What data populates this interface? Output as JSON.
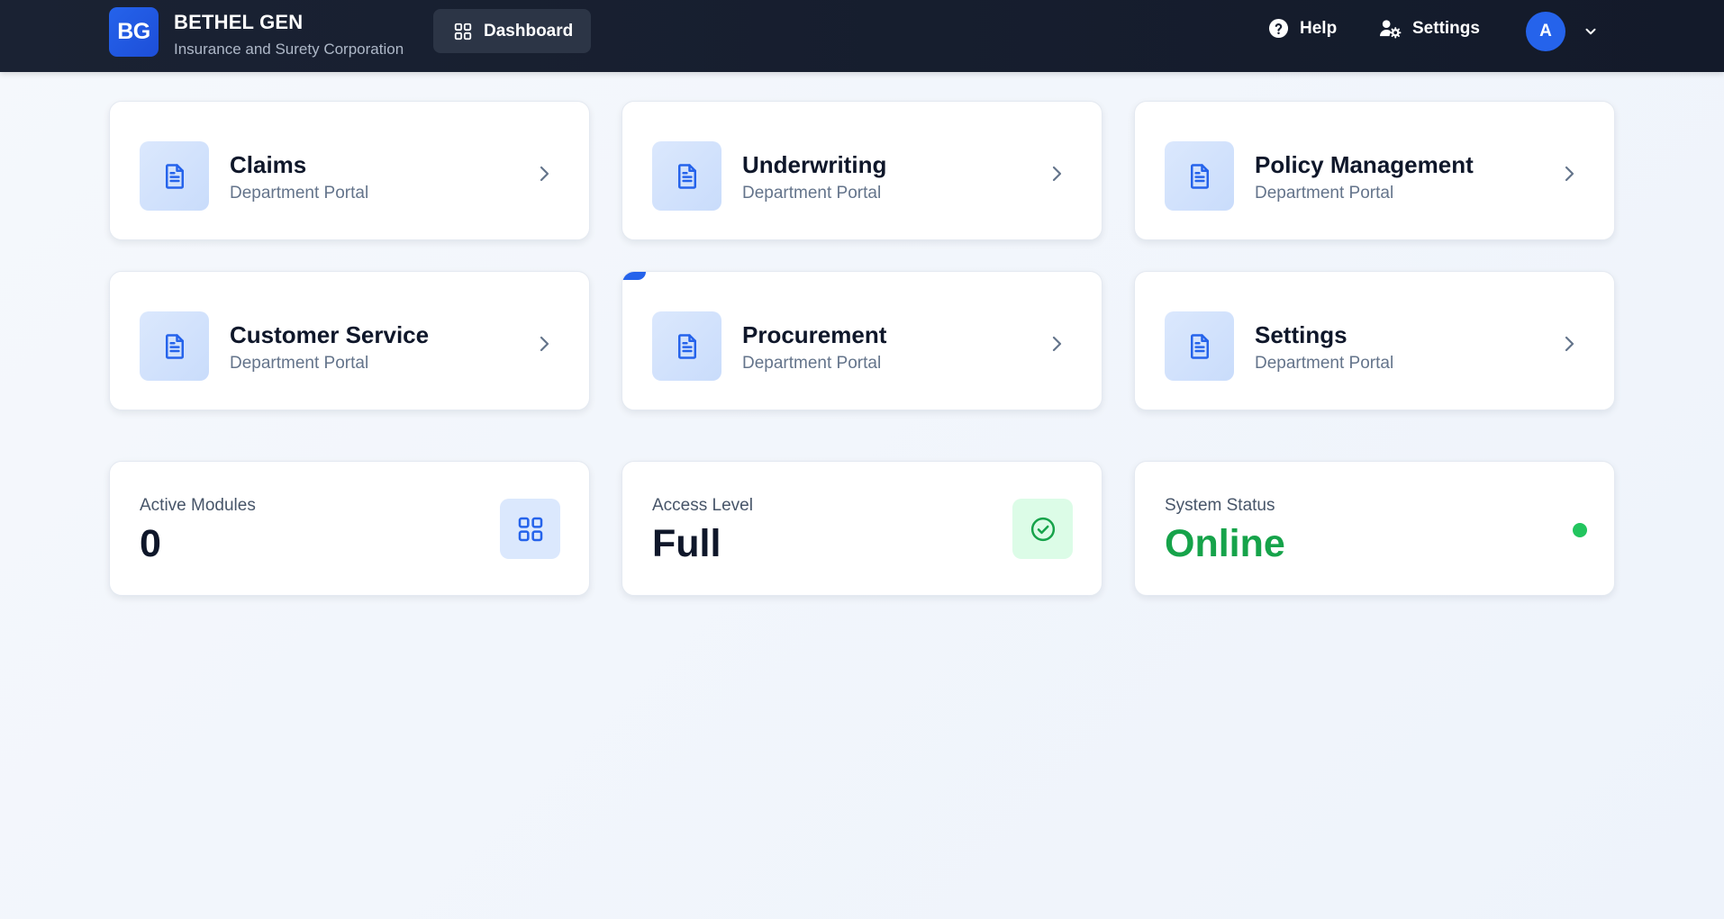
{
  "header": {
    "logo_text": "BG",
    "brand_name": "BETHEL GEN",
    "brand_subtitle": "Insurance and Surety Corporation",
    "nav_dashboard": "Dashboard",
    "help": "Help",
    "settings": "Settings",
    "avatar_initial": "A"
  },
  "modules": [
    {
      "title": "Claims",
      "subtitle": "Department Portal"
    },
    {
      "title": "Underwriting",
      "subtitle": "Department Portal"
    },
    {
      "title": "Policy Management",
      "subtitle": "Department Portal"
    },
    {
      "title": "Customer Service",
      "subtitle": "Department Portal"
    },
    {
      "title": "Procurement",
      "subtitle": "Department Portal"
    },
    {
      "title": "Settings",
      "subtitle": "Department Portal"
    }
  ],
  "stats": {
    "active_modules": {
      "label": "Active Modules",
      "value": "0"
    },
    "access_level": {
      "label": "Access Level",
      "value": "Full"
    },
    "system_status": {
      "label": "System Status",
      "value": "Online"
    }
  },
  "colors": {
    "accent": "#2563eb",
    "header_bg": "#1a2233",
    "status_green": "#16a34a",
    "status_dot": "#22c55e"
  },
  "icons": {
    "module_icon": "document-icon",
    "chevron": "chevron-right-icon",
    "active_modules_badge": "grid-icon",
    "access_level_badge": "check-circle-icon"
  }
}
